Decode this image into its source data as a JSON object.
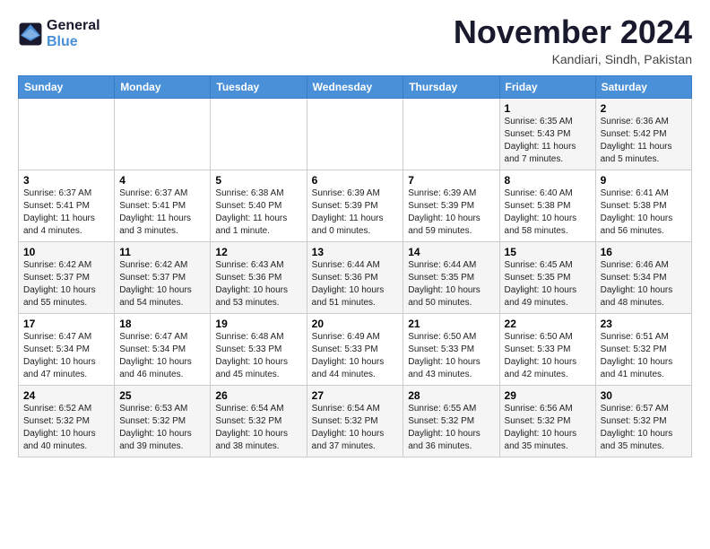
{
  "logo": {
    "line1": "General",
    "line2": "Blue"
  },
  "header": {
    "month": "November 2024",
    "location": "Kandiari, Sindh, Pakistan"
  },
  "weekdays": [
    "Sunday",
    "Monday",
    "Tuesday",
    "Wednesday",
    "Thursday",
    "Friday",
    "Saturday"
  ],
  "rows": [
    [
      {
        "day": "",
        "info": ""
      },
      {
        "day": "",
        "info": ""
      },
      {
        "day": "",
        "info": ""
      },
      {
        "day": "",
        "info": ""
      },
      {
        "day": "",
        "info": ""
      },
      {
        "day": "1",
        "info": "Sunrise: 6:35 AM\nSunset: 5:43 PM\nDaylight: 11 hours\nand 7 minutes."
      },
      {
        "day": "2",
        "info": "Sunrise: 6:36 AM\nSunset: 5:42 PM\nDaylight: 11 hours\nand 5 minutes."
      }
    ],
    [
      {
        "day": "3",
        "info": "Sunrise: 6:37 AM\nSunset: 5:41 PM\nDaylight: 11 hours\nand 4 minutes."
      },
      {
        "day": "4",
        "info": "Sunrise: 6:37 AM\nSunset: 5:41 PM\nDaylight: 11 hours\nand 3 minutes."
      },
      {
        "day": "5",
        "info": "Sunrise: 6:38 AM\nSunset: 5:40 PM\nDaylight: 11 hours\nand 1 minute."
      },
      {
        "day": "6",
        "info": "Sunrise: 6:39 AM\nSunset: 5:39 PM\nDaylight: 11 hours\nand 0 minutes."
      },
      {
        "day": "7",
        "info": "Sunrise: 6:39 AM\nSunset: 5:39 PM\nDaylight: 10 hours\nand 59 minutes."
      },
      {
        "day": "8",
        "info": "Sunrise: 6:40 AM\nSunset: 5:38 PM\nDaylight: 10 hours\nand 58 minutes."
      },
      {
        "day": "9",
        "info": "Sunrise: 6:41 AM\nSunset: 5:38 PM\nDaylight: 10 hours\nand 56 minutes."
      }
    ],
    [
      {
        "day": "10",
        "info": "Sunrise: 6:42 AM\nSunset: 5:37 PM\nDaylight: 10 hours\nand 55 minutes."
      },
      {
        "day": "11",
        "info": "Sunrise: 6:42 AM\nSunset: 5:37 PM\nDaylight: 10 hours\nand 54 minutes."
      },
      {
        "day": "12",
        "info": "Sunrise: 6:43 AM\nSunset: 5:36 PM\nDaylight: 10 hours\nand 53 minutes."
      },
      {
        "day": "13",
        "info": "Sunrise: 6:44 AM\nSunset: 5:36 PM\nDaylight: 10 hours\nand 51 minutes."
      },
      {
        "day": "14",
        "info": "Sunrise: 6:44 AM\nSunset: 5:35 PM\nDaylight: 10 hours\nand 50 minutes."
      },
      {
        "day": "15",
        "info": "Sunrise: 6:45 AM\nSunset: 5:35 PM\nDaylight: 10 hours\nand 49 minutes."
      },
      {
        "day": "16",
        "info": "Sunrise: 6:46 AM\nSunset: 5:34 PM\nDaylight: 10 hours\nand 48 minutes."
      }
    ],
    [
      {
        "day": "17",
        "info": "Sunrise: 6:47 AM\nSunset: 5:34 PM\nDaylight: 10 hours\nand 47 minutes."
      },
      {
        "day": "18",
        "info": "Sunrise: 6:47 AM\nSunset: 5:34 PM\nDaylight: 10 hours\nand 46 minutes."
      },
      {
        "day": "19",
        "info": "Sunrise: 6:48 AM\nSunset: 5:33 PM\nDaylight: 10 hours\nand 45 minutes."
      },
      {
        "day": "20",
        "info": "Sunrise: 6:49 AM\nSunset: 5:33 PM\nDaylight: 10 hours\nand 44 minutes."
      },
      {
        "day": "21",
        "info": "Sunrise: 6:50 AM\nSunset: 5:33 PM\nDaylight: 10 hours\nand 43 minutes."
      },
      {
        "day": "22",
        "info": "Sunrise: 6:50 AM\nSunset: 5:33 PM\nDaylight: 10 hours\nand 42 minutes."
      },
      {
        "day": "23",
        "info": "Sunrise: 6:51 AM\nSunset: 5:32 PM\nDaylight: 10 hours\nand 41 minutes."
      }
    ],
    [
      {
        "day": "24",
        "info": "Sunrise: 6:52 AM\nSunset: 5:32 PM\nDaylight: 10 hours\nand 40 minutes."
      },
      {
        "day": "25",
        "info": "Sunrise: 6:53 AM\nSunset: 5:32 PM\nDaylight: 10 hours\nand 39 minutes."
      },
      {
        "day": "26",
        "info": "Sunrise: 6:54 AM\nSunset: 5:32 PM\nDaylight: 10 hours\nand 38 minutes."
      },
      {
        "day": "27",
        "info": "Sunrise: 6:54 AM\nSunset: 5:32 PM\nDaylight: 10 hours\nand 37 minutes."
      },
      {
        "day": "28",
        "info": "Sunrise: 6:55 AM\nSunset: 5:32 PM\nDaylight: 10 hours\nand 36 minutes."
      },
      {
        "day": "29",
        "info": "Sunrise: 6:56 AM\nSunset: 5:32 PM\nDaylight: 10 hours\nand 35 minutes."
      },
      {
        "day": "30",
        "info": "Sunrise: 6:57 AM\nSunset: 5:32 PM\nDaylight: 10 hours\nand 35 minutes."
      }
    ]
  ]
}
